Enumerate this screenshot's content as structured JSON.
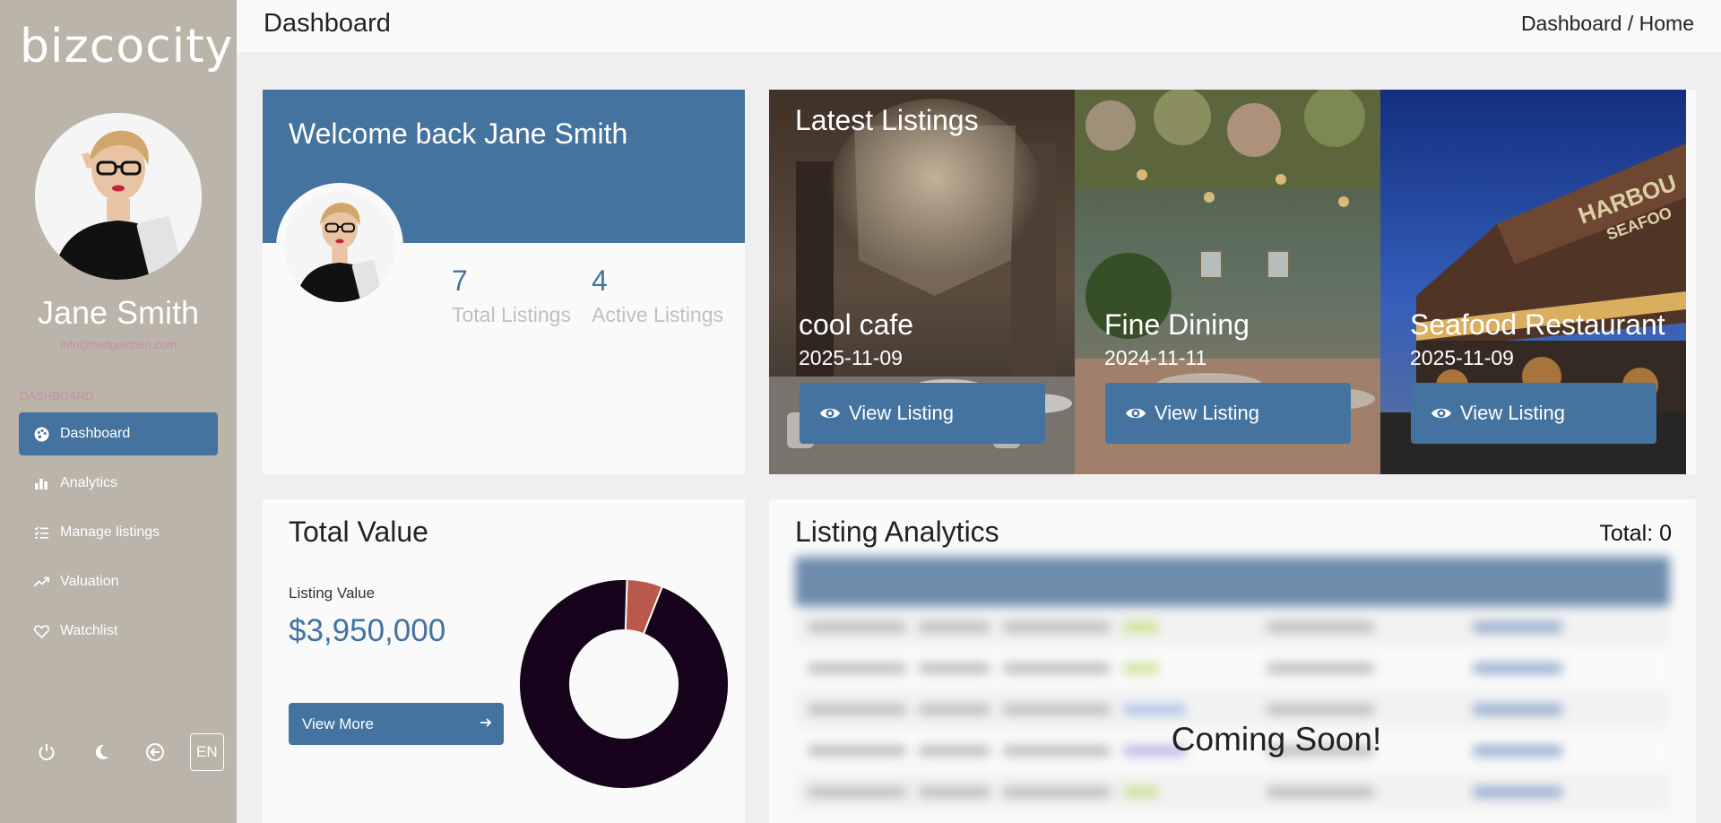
{
  "brand": {
    "logo": "bizcocity"
  },
  "user": {
    "name": "Jane Smith",
    "email": "info@hedgekitten.com"
  },
  "sidebar": {
    "section_label": "DASHBOARD",
    "items": [
      {
        "label": "Dashboard",
        "icon": "palette-icon",
        "active": true
      },
      {
        "label": "Analytics",
        "icon": "bar-chart-icon",
        "active": false
      },
      {
        "label": "Manage listings",
        "icon": "list-check-icon",
        "active": false
      },
      {
        "label": "Valuation",
        "icon": "trending-up-icon",
        "active": false
      },
      {
        "label": "Watchlist",
        "icon": "heart-icon",
        "active": false
      }
    ],
    "footer": {
      "power_icon": "power-icon",
      "theme_icon": "moon-icon",
      "back_icon": "circle-arrow-left-icon",
      "language": "EN"
    }
  },
  "header": {
    "title": "Dashboard",
    "breadcrumb": {
      "first": "Dashboard",
      "separator": " / ",
      "second": "Home"
    }
  },
  "welcome": {
    "title": "Welcome back Jane Smith",
    "stats": [
      {
        "value": "7",
        "label": "Total Listings"
      },
      {
        "value": "4",
        "label": "Active Listings"
      }
    ]
  },
  "latest_listings": {
    "title": "Latest Listings",
    "button_label": "View Listing",
    "items": [
      {
        "name": "cool cafe",
        "date": "2025-11-09"
      },
      {
        "name": "Fine Dining",
        "date": "2024-11-11"
      },
      {
        "name": "Seafood Restaurant",
        "date": "2025-11-09"
      }
    ]
  },
  "total_value": {
    "title": "Total Value",
    "label": "Listing Value",
    "value": "$3,950,000",
    "button_label": "View More",
    "donut": {
      "shares": [
        0.055,
        0.945
      ],
      "colors": [
        "#b9584b",
        "#17031b"
      ]
    }
  },
  "listing_analytics": {
    "title": "Listing Analytics",
    "total": "Total: 0",
    "overlay": "Coming Soon!"
  },
  "colors": {
    "accent": "#44739f",
    "sidebar": "#bab4a9",
    "email": "#c68fa6"
  }
}
